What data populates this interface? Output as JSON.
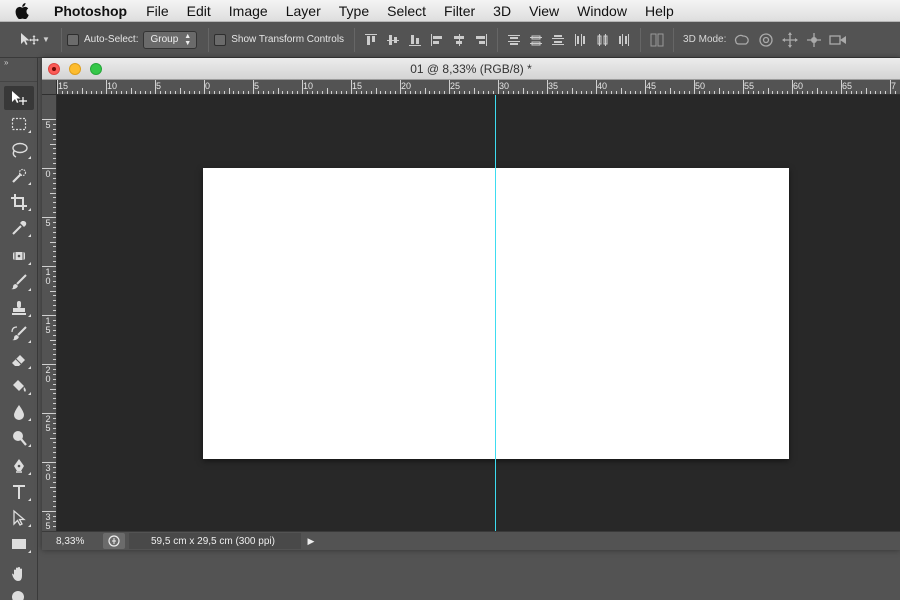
{
  "menubar": {
    "items": [
      "Photoshop",
      "File",
      "Edit",
      "Image",
      "Layer",
      "Type",
      "Select",
      "Filter",
      "3D",
      "View",
      "Window",
      "Help"
    ]
  },
  "options": {
    "auto_select_label": "Auto-Select:",
    "auto_select_value": "Group",
    "transform_controls_label": "Show Transform Controls",
    "mode_label": "3D Mode:"
  },
  "document": {
    "title": "01 @ 8,33% (RGB/8) *",
    "zoom": "8,33%",
    "doc_info": "59,5 cm x 29,5 cm (300 ppi)"
  },
  "rulers": {
    "h_labels": [
      "15",
      "10",
      "5",
      "0",
      "5",
      "10",
      "15",
      "20",
      "25",
      "30",
      "35",
      "40",
      "45",
      "50",
      "55",
      "60",
      "65",
      "7"
    ],
    "v_labels": [
      "5",
      "0",
      "5",
      "1\n0",
      "1\n5",
      "2\n0",
      "2\n5",
      "3\n0",
      "3\n5"
    ]
  },
  "icons": {
    "apple": "apple-logo-icon",
    "move": "move-tool-icon",
    "marquee": "rectangular-marquee-icon",
    "lasso": "lasso-icon",
    "quick_select": "quick-selection-icon",
    "crop": "crop-icon",
    "eyedropper": "eyedropper-icon",
    "healing": "healing-brush-icon",
    "brush": "brush-icon",
    "stamp": "clone-stamp-icon",
    "history_brush": "history-brush-icon",
    "eraser": "eraser-icon",
    "bucket": "paint-bucket-icon",
    "blur": "blur-icon",
    "dodge": "dodge-icon",
    "pen": "pen-icon",
    "type": "type-icon",
    "path_select": "path-selection-icon",
    "shape": "rectangle-shape-icon",
    "hand": "hand-icon"
  },
  "colors": {
    "guide": "#3ddcf0",
    "pasteboard": "#282828",
    "ui_gray": "#535353"
  }
}
